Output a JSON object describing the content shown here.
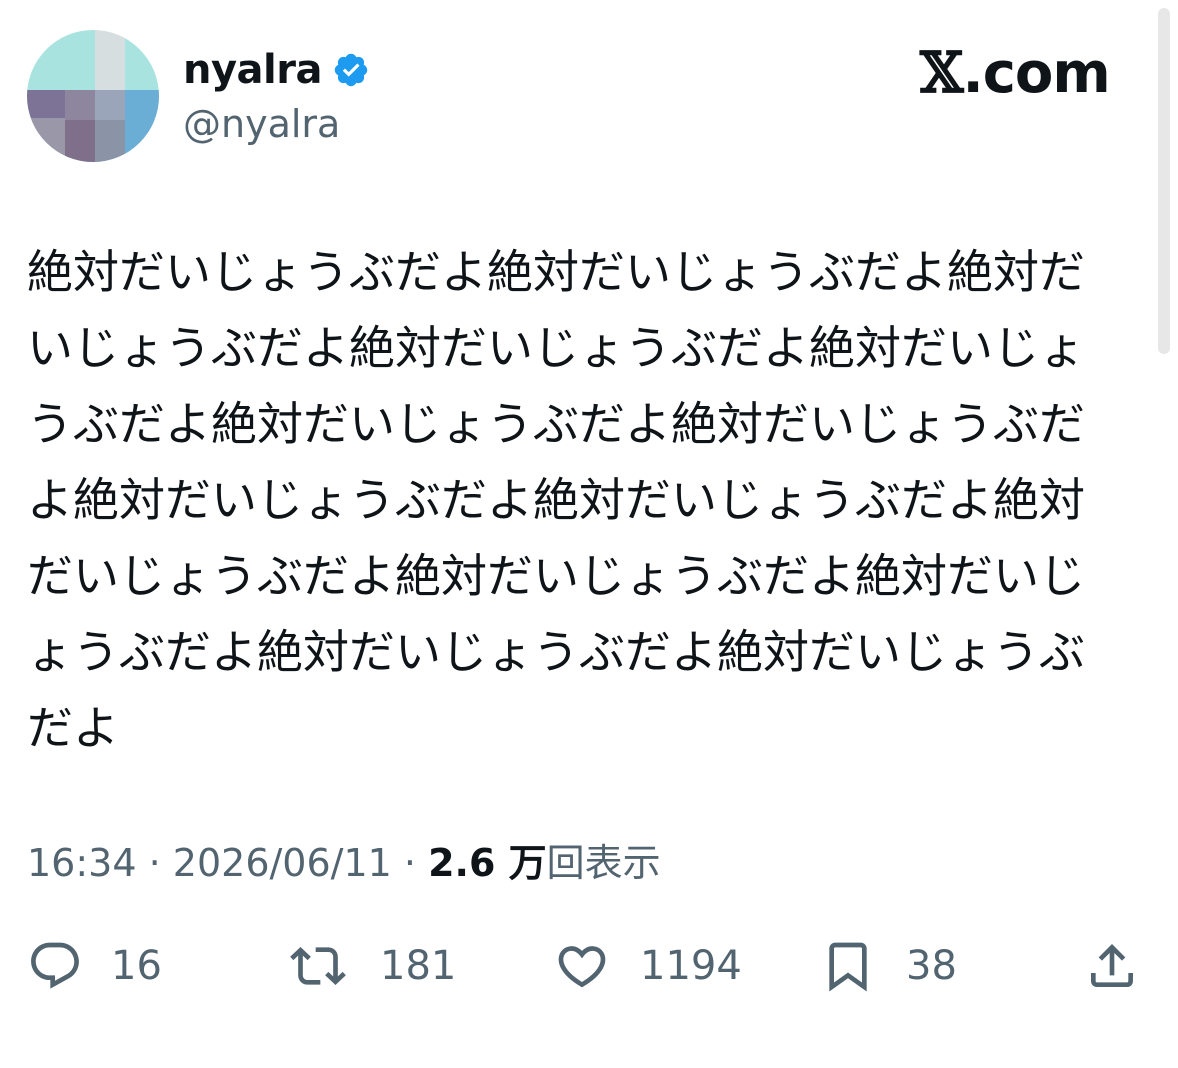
{
  "author": {
    "display_name": "nyalra",
    "handle": "@nyalra",
    "verified": true,
    "verified_color": "#1d9bf0"
  },
  "brand": {
    "x_letter": "𝕏",
    "suffix": ".com"
  },
  "post": {
    "text": "絶対だいじょうぶだよ絶対だいじょうぶだよ絶対だいじょうぶだよ絶対だいじょうぶだよ絶対だいじょうぶだよ絶対だいじょうぶだよ絶対だいじょうぶだよ絶対だいじょうぶだよ絶対だいじょうぶだよ絶対だいじょうぶだよ絶対だいじょうぶだよ絶対だいじょうぶだよ絶対だいじょうぶだよ絶対だいじょうぶだよ"
  },
  "meta": {
    "time": "16:34",
    "separator": "·",
    "date": "2026/06/11",
    "views_count": "2.6 万",
    "views_label": "回表示"
  },
  "actions": {
    "reply_count": "16",
    "repost_count": "181",
    "like_count": "1194",
    "bookmark_count": "38"
  },
  "icons": [
    "verified-badge-icon",
    "reply-icon",
    "repost-icon",
    "like-icon",
    "bookmark-icon",
    "share-icon"
  ],
  "colors": {
    "text_primary": "#0f1419",
    "text_secondary": "#536471",
    "avatar_bg": "#a9e3df"
  }
}
